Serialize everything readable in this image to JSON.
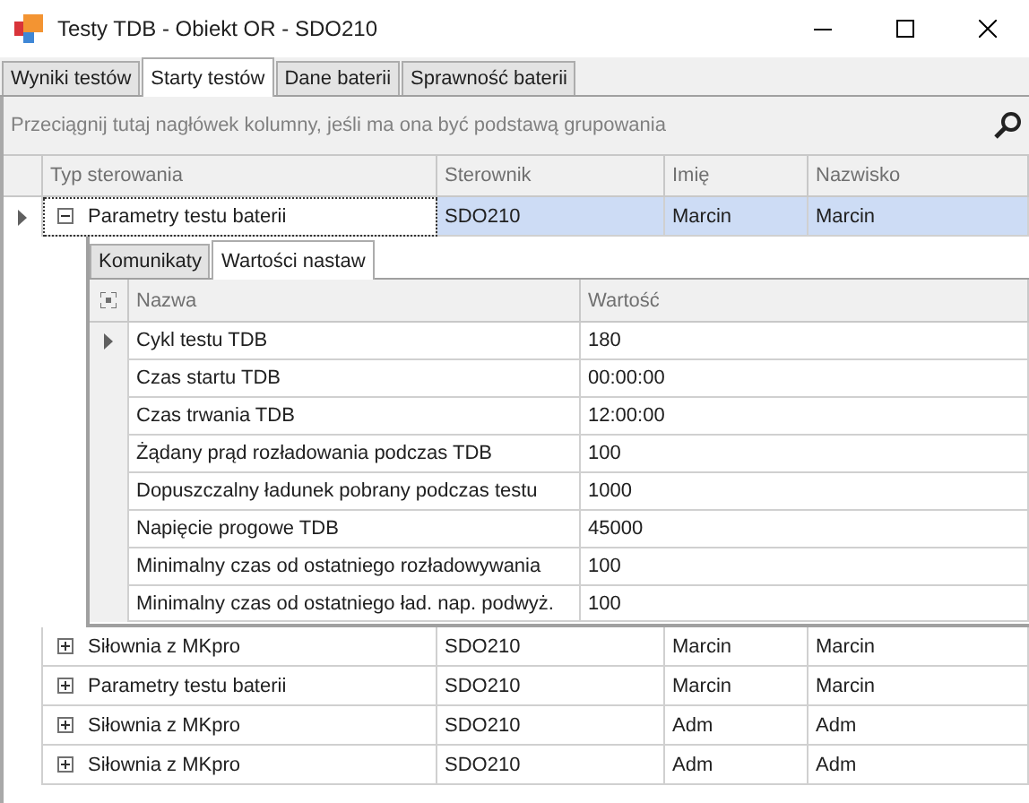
{
  "window": {
    "title": "Testy TDB - Obiekt OR - SDO210"
  },
  "tabs": [
    {
      "label": "Wyniki testów",
      "selected": false
    },
    {
      "label": "Starty testów",
      "selected": true
    },
    {
      "label": "Dane baterii",
      "selected": false
    },
    {
      "label": "Sprawność baterii",
      "selected": false
    }
  ],
  "group_panel": {
    "placeholder": "Przeciągnij tutaj nagłówek kolumny, jeśli ma ona być podstawą grupowania"
  },
  "table": {
    "columns": [
      "Typ sterowania",
      "Sterownik",
      "Imię",
      "Nazwisko"
    ],
    "rows": [
      {
        "cells": [
          "Parametry testu baterii",
          "SDO210",
          "Marcin",
          "Marcin"
        ],
        "expanded": true,
        "selected": true,
        "current": true,
        "detail": {
          "tabs": [
            {
              "label": "Komunikaty",
              "selected": false
            },
            {
              "label": "Wartości nastaw",
              "selected": true
            }
          ],
          "columns": [
            "Nazwa",
            "Wartość"
          ],
          "rows": [
            {
              "cells": [
                "Cykl testu TDB",
                "180"
              ],
              "current": true
            },
            {
              "cells": [
                "Czas startu TDB",
                "00:00:00"
              ],
              "current": false
            },
            {
              "cells": [
                "Czas trwania TDB",
                "12:00:00"
              ],
              "current": false
            },
            {
              "cells": [
                "Żądany prąd rozładowania podczas TDB",
                "100"
              ],
              "current": false
            },
            {
              "cells": [
                "Dopuszczalny ładunek pobrany podczas testu",
                "1000"
              ],
              "current": false
            },
            {
              "cells": [
                "Napięcie progowe TDB",
                "45000"
              ],
              "current": false
            },
            {
              "cells": [
                "Minimalny czas od ostatniego rozładowywania",
                "100"
              ],
              "current": false
            },
            {
              "cells": [
                "Minimalny czas od ostatniego ład. nap. podwyż.",
                "100"
              ],
              "current": false
            }
          ]
        }
      },
      {
        "cells": [
          "Siłownia z MKpro",
          "SDO210",
          "Marcin",
          "Marcin"
        ],
        "expanded": false,
        "selected": false,
        "current": false
      },
      {
        "cells": [
          "Parametry testu baterii",
          "SDO210",
          "Marcin",
          "Marcin"
        ],
        "expanded": false,
        "selected": false,
        "current": false
      },
      {
        "cells": [
          "Siłownia z MKpro",
          "SDO210",
          "Adm",
          "Adm"
        ],
        "expanded": false,
        "selected": false,
        "current": false
      },
      {
        "cells": [
          "Siłownia z MKpro",
          "SDO210",
          "Adm",
          "Adm"
        ],
        "expanded": false,
        "selected": false,
        "current": false
      }
    ]
  }
}
